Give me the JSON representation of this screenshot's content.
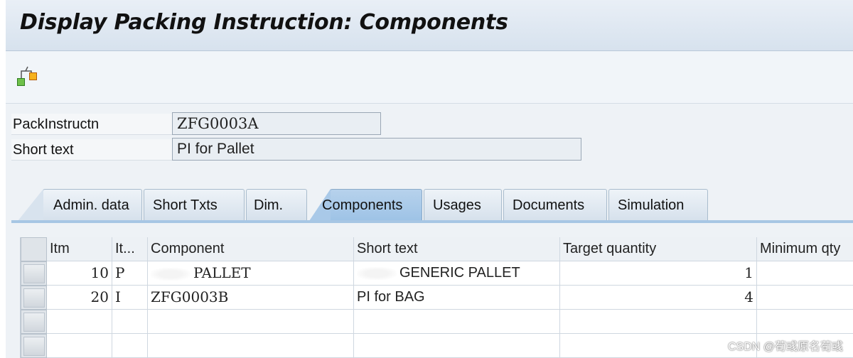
{
  "window": {
    "title": "Display Packing Instruction: Components"
  },
  "toolbar": {
    "hierarchy_icon": "hierarchy-icon"
  },
  "header": {
    "pack_instr_label": "PackInstructn",
    "pack_instr_value": "ZFG0003A",
    "short_text_label": "Short text",
    "short_text_value": "PI for Pallet"
  },
  "tabs": [
    {
      "label": "Admin. data",
      "active": false
    },
    {
      "label": "Short Txts",
      "active": false
    },
    {
      "label": "Dim.",
      "active": false
    },
    {
      "label": "Components",
      "active": true
    },
    {
      "label": "Usages",
      "active": false
    },
    {
      "label": "Documents",
      "active": false
    },
    {
      "label": "Simulation",
      "active": false
    }
  ],
  "table": {
    "columns": [
      "Itm",
      "It...",
      "Component",
      "Short text",
      "Target quantity",
      "Minimum qty"
    ],
    "rows": [
      {
        "itm": "10",
        "type": "P",
        "component": "PALLET",
        "short_text": "GENERIC PALLET",
        "target_qty": "1",
        "min_qty": ""
      },
      {
        "itm": "20",
        "type": "I",
        "component": "ZFG0003B",
        "short_text": "PI for BAG",
        "target_qty": "4",
        "min_qty": ""
      }
    ]
  },
  "watermark": "CSDN @荀彧原名荀彧",
  "colors": {
    "active_tab": "#9ec3e6",
    "title_bg": "#d7e2ee"
  }
}
